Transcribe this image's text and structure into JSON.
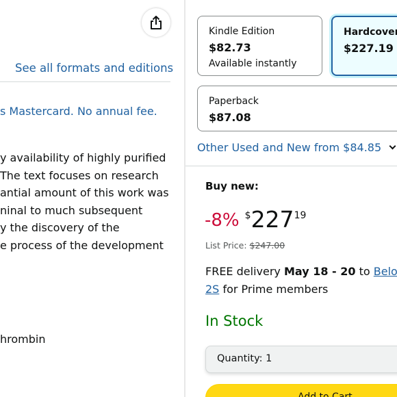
{
  "left": {
    "formats_link": "See all formats and editions",
    "card_offer": "s Mastercard. No annual fee.",
    "description_lines": [
      "y availability of highly purified",
      " The text focuses on research",
      "antial amount of this work was",
      "ninal to much subsequent",
      "y the discovery of the",
      "e process of the development"
    ],
    "extra_line": "hrombin"
  },
  "formats": [
    {
      "name": "Kindle Edition",
      "price": "$82.73",
      "sub": "Available instantly",
      "selected": false
    },
    {
      "name": "Hardcover",
      "price": "$227.19",
      "sub": "",
      "selected": true
    },
    {
      "name": "Paperback",
      "price": "$87.08",
      "sub": "",
      "selected": false
    }
  ],
  "other_offers": {
    "text": "Other Used and New from",
    "price": "$84.85"
  },
  "buybox": {
    "heading": "Buy new:",
    "discount": "-8%",
    "currency": "$",
    "price_whole": "227",
    "price_fraction": "19",
    "list_price_label": "List Price:",
    "list_price": "$247.00",
    "delivery_prefix": "FREE delivery",
    "delivery_dates": "May 18 - 20",
    "delivery_to": "to",
    "delivery_location_1": "Beloo",
    "delivery_location_2": "2S",
    "delivery_suffix": "for Prime members",
    "stock": "In Stock",
    "quantity_label": "Quantity:",
    "quantity_value": "1",
    "add_to_cart": "Add to Cart"
  },
  "colors": {
    "link": "#2162a1",
    "discount": "#cc0c39",
    "in_stock": "#007600",
    "add_to_cart_bg": "#ffd814",
    "selected_border": "#2162a1"
  },
  "icons": {
    "share": "share-icon",
    "chevron": "chevron-down-icon"
  }
}
